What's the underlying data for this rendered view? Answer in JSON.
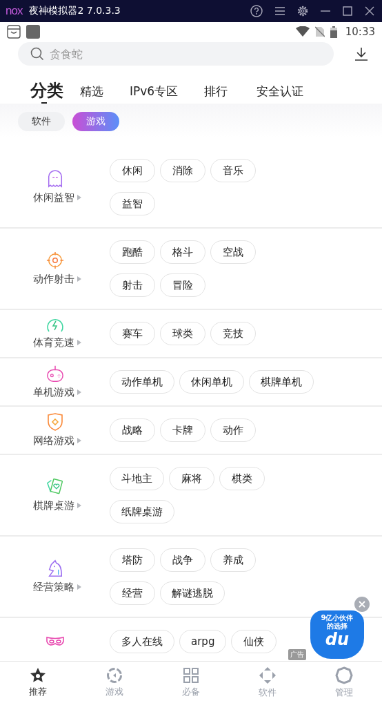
{
  "window": {
    "logo": "nox",
    "title": "夜神模拟器2 7.0.3.3"
  },
  "status_bar": {
    "time": "10:33"
  },
  "search": {
    "placeholder": "贪食蛇"
  },
  "tabs": [
    {
      "label": "分类",
      "selected": true
    },
    {
      "label": "精选",
      "selected": false
    },
    {
      "label": "IPv6专区",
      "selected": false
    },
    {
      "label": "排行",
      "selected": false
    },
    {
      "label": "安全认证",
      "selected": false
    }
  ],
  "segments": [
    {
      "label": "软件",
      "selected": false
    },
    {
      "label": "游戏",
      "selected": true
    }
  ],
  "categories": [
    {
      "name": "休闲益智",
      "tags": [
        "休闲",
        "消除",
        "音乐",
        "益智"
      ]
    },
    {
      "name": "动作射击",
      "tags": [
        "跑酷",
        "格斗",
        "空战",
        "射击",
        "冒险"
      ]
    },
    {
      "name": "体育竞速",
      "tags": [
        "赛车",
        "球类",
        "竞技"
      ]
    },
    {
      "name": "单机游戏",
      "tags": [
        "动作单机",
        "休闲单机",
        "棋牌单机"
      ]
    },
    {
      "name": "网络游戏",
      "tags": [
        "战略",
        "卡牌",
        "动作"
      ]
    },
    {
      "name": "棋牌桌游",
      "tags": [
        "斗地主",
        "麻将",
        "棋类",
        "纸牌桌游"
      ]
    },
    {
      "name": "经营策略",
      "tags": [
        "塔防",
        "战争",
        "养成",
        "经营",
        "解谜逃脱"
      ]
    },
    {
      "tags": [
        "多人在线",
        "arpg",
        "仙侠"
      ]
    }
  ],
  "ad": {
    "slogan": "9亿小伙伴的选择",
    "brand": "du",
    "tag": "广告"
  },
  "bottom_nav": [
    {
      "label": "推荐",
      "selected": true
    },
    {
      "label": "游戏",
      "selected": false
    },
    {
      "label": "必备",
      "selected": false
    },
    {
      "label": "软件",
      "selected": false
    },
    {
      "label": "管理",
      "selected": false
    }
  ]
}
